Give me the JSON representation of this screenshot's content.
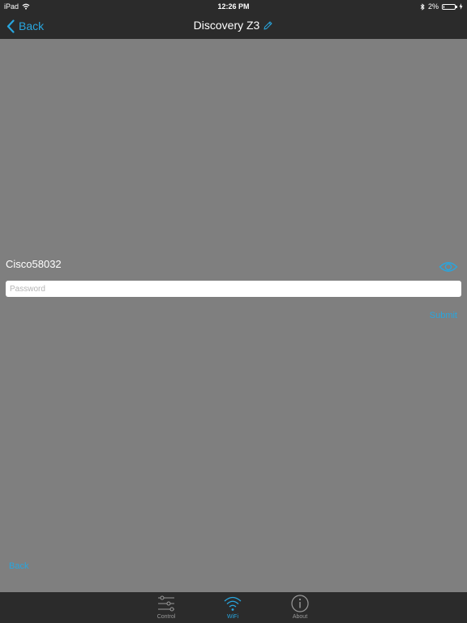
{
  "status_bar": {
    "device": "iPad",
    "time": "12:26 PM",
    "battery_percent": "2%"
  },
  "nav": {
    "back_label": "Back",
    "title": "Discovery Z3"
  },
  "wifi_form": {
    "network_name": "Cisco58032",
    "password_placeholder": "Password",
    "password_value": "",
    "submit_label": "Submit"
  },
  "footer": {
    "back_label": "Back"
  },
  "tabs": [
    {
      "label": "Control",
      "icon": "sliders-icon",
      "active": false
    },
    {
      "label": "WiFi",
      "icon": "wifi-icon",
      "active": true
    },
    {
      "label": "About",
      "icon": "info-icon",
      "active": false
    }
  ],
  "colors": {
    "accent": "#28a6df",
    "bar_background": "#2b2b2b",
    "content_background": "#7f7f7f"
  }
}
